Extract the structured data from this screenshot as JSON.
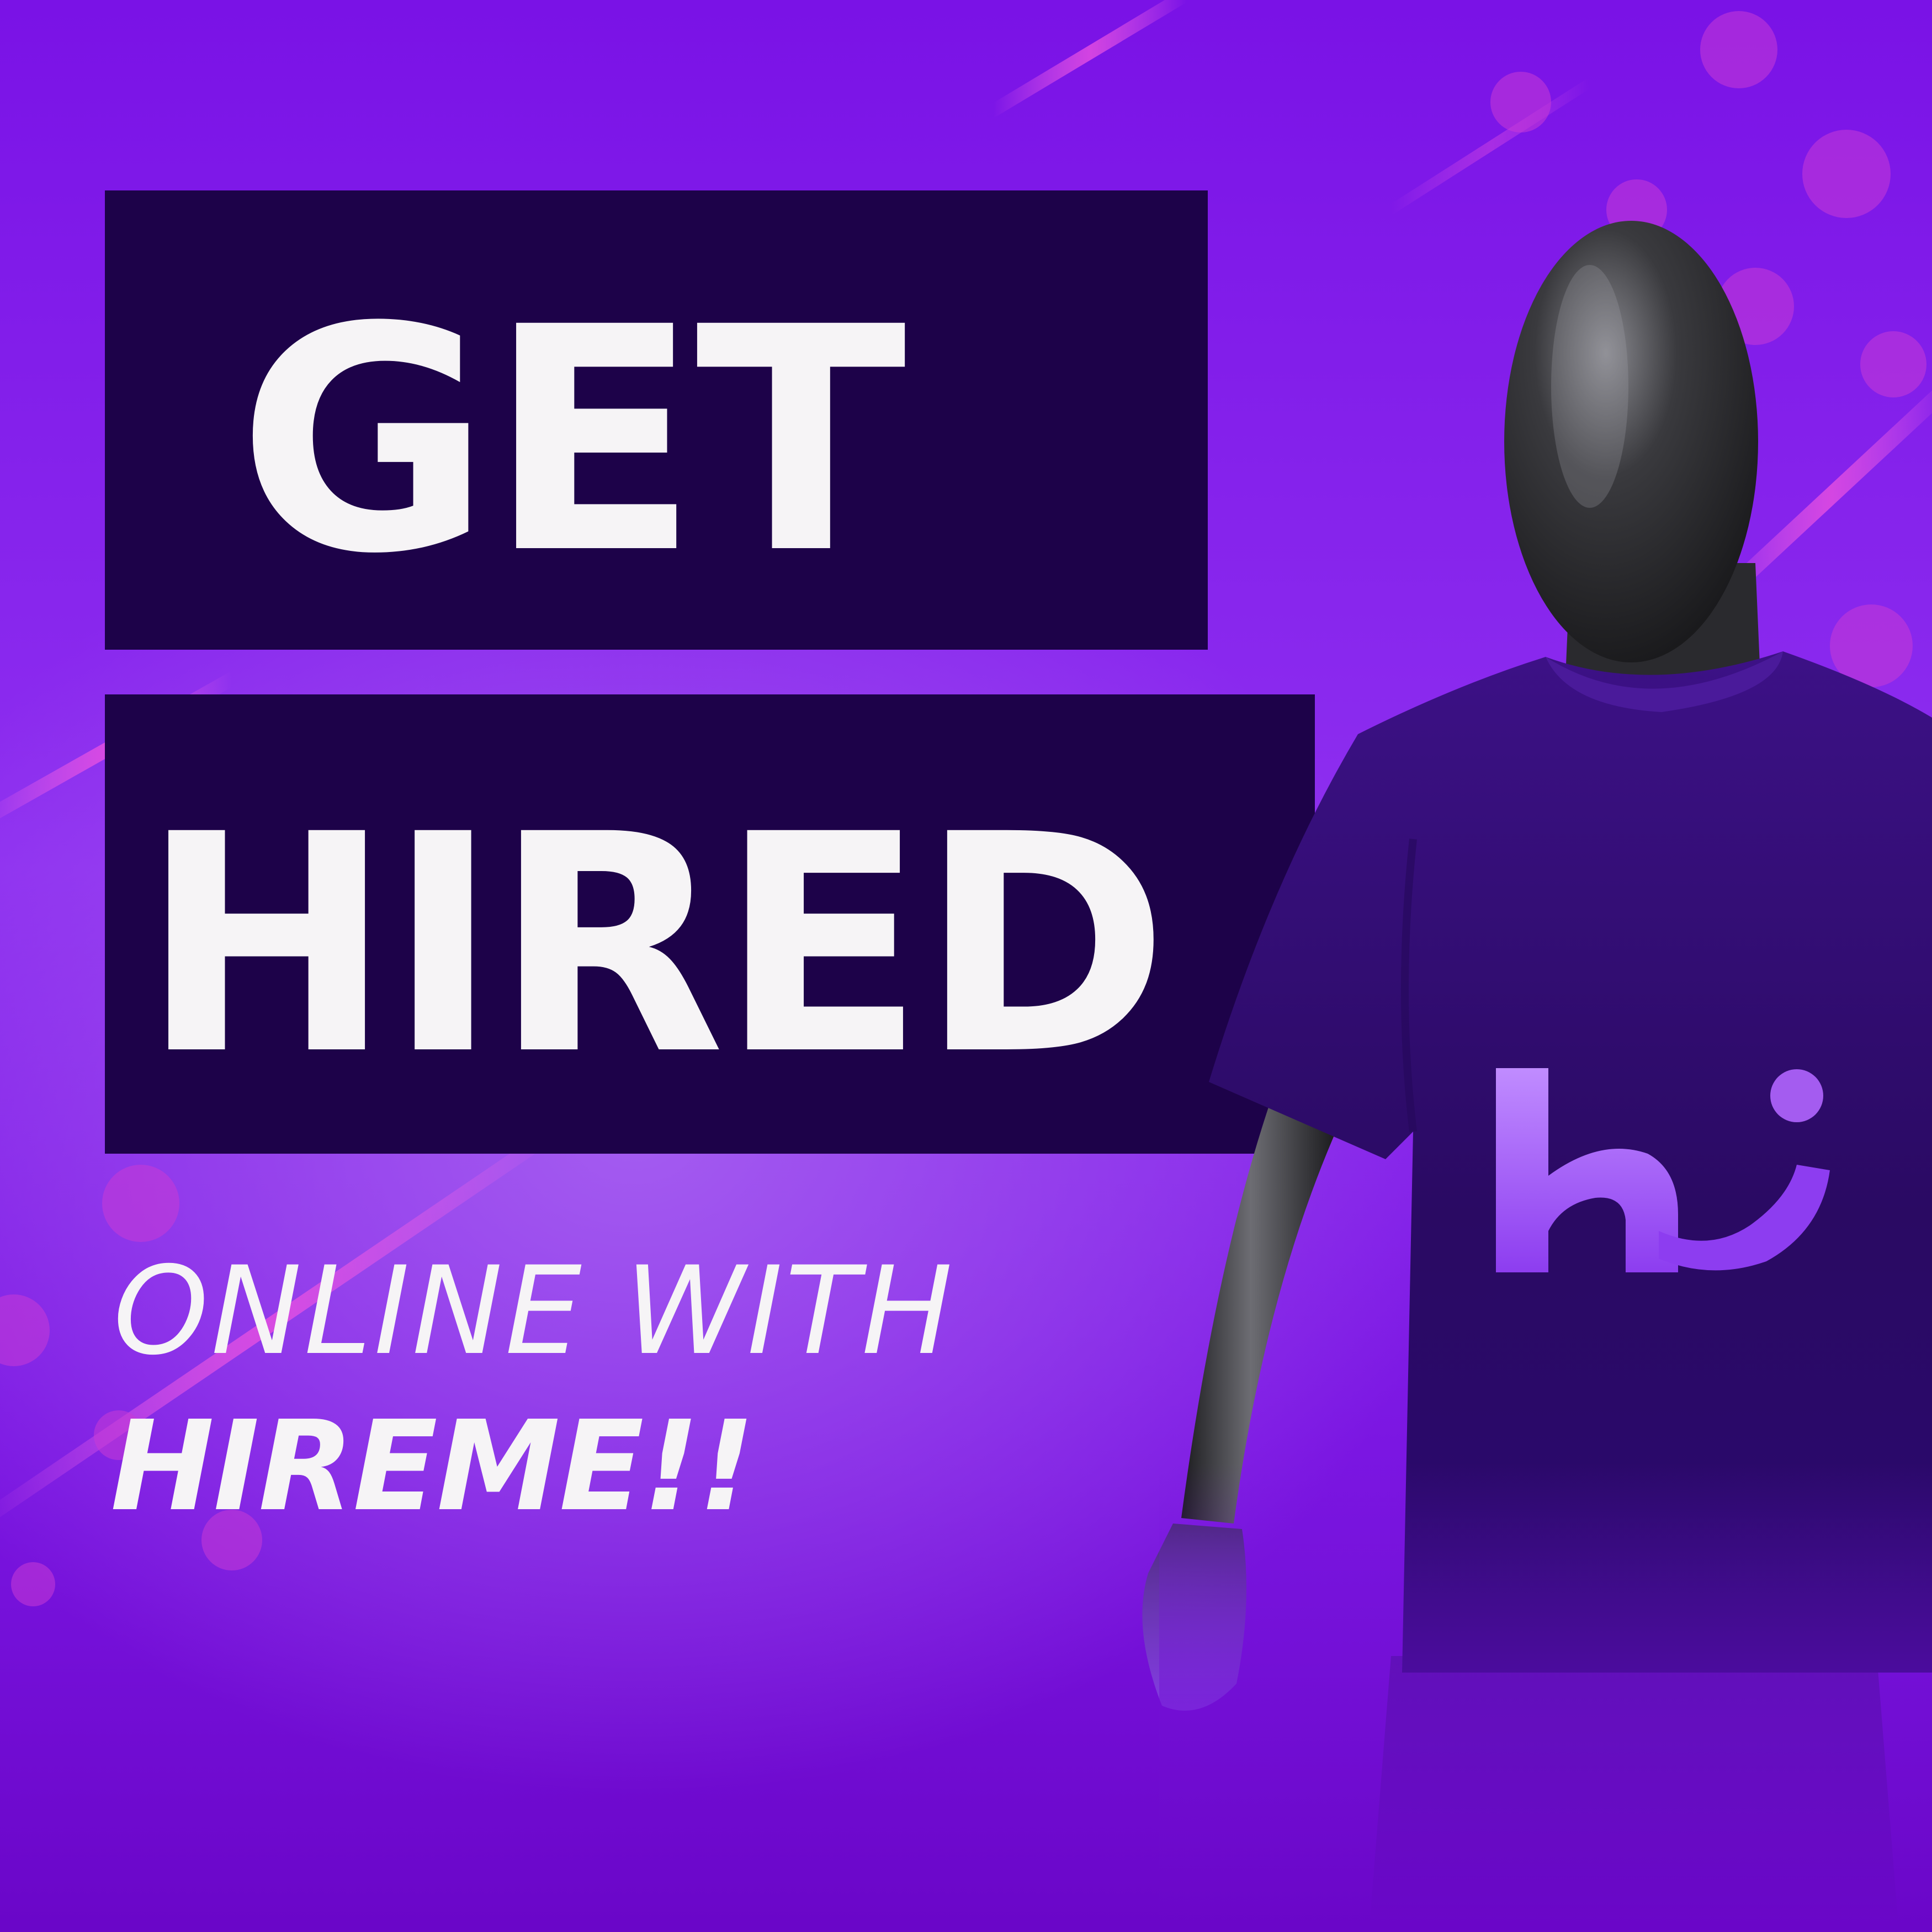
{
  "headline": {
    "line1": "GET",
    "line2": "HIRED"
  },
  "subheadline": {
    "line1": "ONLINE WITH",
    "line2": "HIREME!!"
  },
  "logo": {
    "mark": "hi"
  },
  "colors": {
    "background": "#7f1ce8",
    "box": "#1d0249",
    "text": "#f6f4f6",
    "shirt": "#3b0f8c",
    "accent": "#a25bf5",
    "bokeh": "#c93bd6"
  },
  "icons": {
    "mannequin": "mannequin-with-tshirt",
    "logo": "hireme-logo-icon"
  }
}
